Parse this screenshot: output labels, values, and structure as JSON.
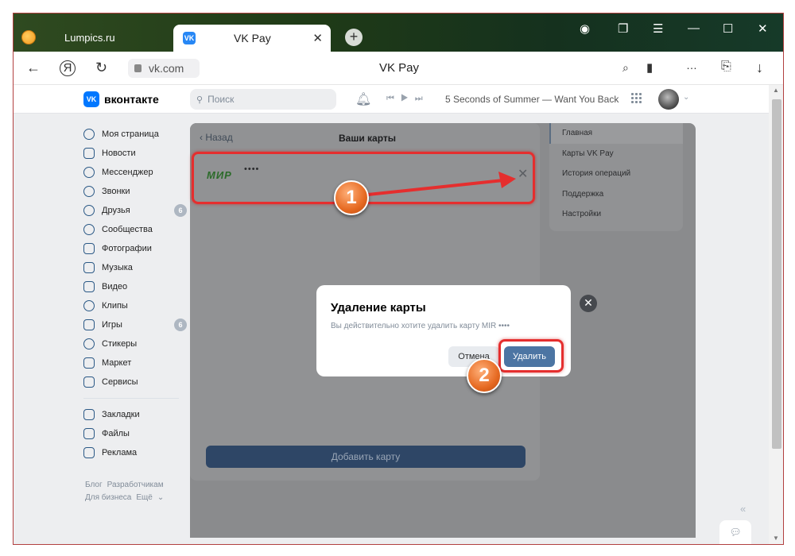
{
  "browser": {
    "tabs": [
      {
        "title": "Lumpics.ru",
        "active": false
      },
      {
        "title": "VK Pay",
        "active": true
      }
    ],
    "url": "vk.com",
    "page_title": "VK Pay"
  },
  "vk_header": {
    "logo_text": "вконтакте",
    "search_placeholder": "Поиск",
    "now_playing": "5 Seconds of Summer — Want You Back"
  },
  "left_menu": {
    "items": [
      {
        "label": "Моя страница",
        "icon": "profile-icon"
      },
      {
        "label": "Новости",
        "icon": "news-icon"
      },
      {
        "label": "Мессенджер",
        "icon": "message-icon"
      },
      {
        "label": "Звонки",
        "icon": "phone-icon"
      },
      {
        "label": "Друзья",
        "icon": "friends-icon",
        "count": "6"
      },
      {
        "label": "Сообщества",
        "icon": "communities-icon"
      },
      {
        "label": "Фотографии",
        "icon": "photos-icon"
      },
      {
        "label": "Музыка",
        "icon": "music-icon"
      },
      {
        "label": "Видео",
        "icon": "video-icon"
      },
      {
        "label": "Клипы",
        "icon": "clips-icon"
      },
      {
        "label": "Игры",
        "icon": "games-icon",
        "count": "6"
      },
      {
        "label": "Стикеры",
        "icon": "stickers-icon"
      },
      {
        "label": "Маркет",
        "icon": "market-icon"
      },
      {
        "label": "Сервисы",
        "icon": "services-icon"
      }
    ],
    "secondary_items": [
      {
        "label": "Закладки",
        "icon": "bookmarks-icon"
      },
      {
        "label": "Файлы",
        "icon": "files-icon"
      },
      {
        "label": "Реклама",
        "icon": "ads-icon"
      }
    ],
    "footer_links": [
      "Блог",
      "Разработчикам",
      "Для бизнеса",
      "Ещё"
    ]
  },
  "cards_panel": {
    "back_label": "Назад",
    "title": "Ваши карты",
    "card": {
      "brand": "МИР",
      "masked_number": "••••"
    },
    "add_card_label": "Добавить карту"
  },
  "right_nav": {
    "items": [
      "Главная",
      "Карты VK Pay",
      "История операций",
      "Поддержка",
      "Настройки"
    ],
    "active_index": 0
  },
  "dialog": {
    "title": "Удаление карты",
    "message": "Вы действительно хотите удалить карту MIR ••••",
    "cancel_label": "Отмена",
    "delete_label": "Удалить"
  },
  "annotations": {
    "step1": "1",
    "step2": "2",
    "highlight_color": "#e52e2e"
  }
}
